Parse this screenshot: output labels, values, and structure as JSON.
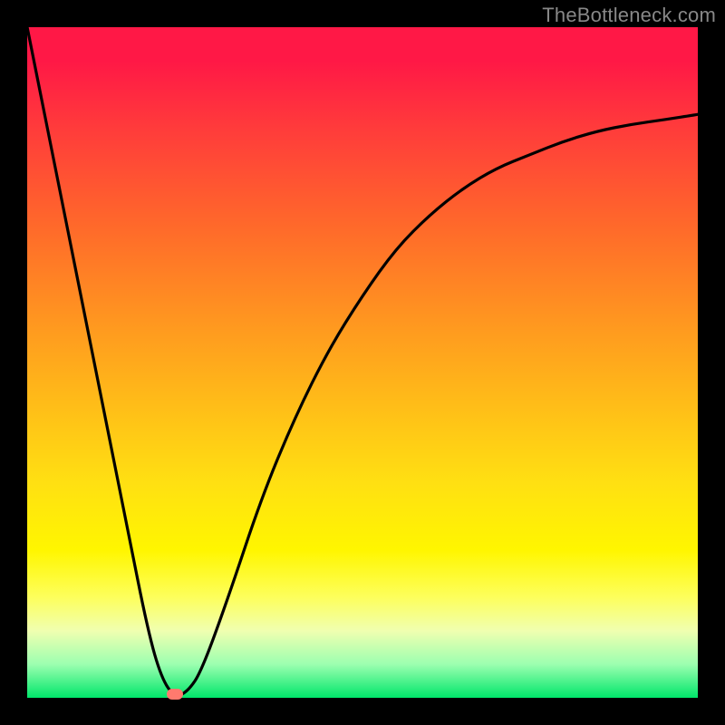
{
  "watermark": "TheBottleneck.com",
  "chart_data": {
    "type": "line",
    "title": "",
    "xlabel": "",
    "ylabel": "",
    "xlim": [
      0,
      1
    ],
    "ylim": [
      0,
      1
    ],
    "series": [
      {
        "name": "curve",
        "x": [
          0.0,
          0.05,
          0.1,
          0.15,
          0.18,
          0.2,
          0.22,
          0.24,
          0.26,
          0.3,
          0.35,
          0.4,
          0.45,
          0.5,
          0.55,
          0.6,
          0.65,
          0.7,
          0.75,
          0.8,
          0.85,
          0.9,
          0.95,
          1.0
        ],
        "y": [
          1.0,
          0.75,
          0.5,
          0.25,
          0.1,
          0.03,
          0.0,
          0.01,
          0.04,
          0.15,
          0.3,
          0.42,
          0.52,
          0.6,
          0.67,
          0.72,
          0.76,
          0.79,
          0.81,
          0.83,
          0.845,
          0.855,
          0.862,
          0.87
        ]
      }
    ],
    "annotations": [
      {
        "name": "min-marker",
        "x": 0.22,
        "y": 0.0
      }
    ],
    "gradient_stops": [
      {
        "pct": 0,
        "color": "#ff1846"
      },
      {
        "pct": 15,
        "color": "#ff3b3b"
      },
      {
        "pct": 30,
        "color": "#ff6a2a"
      },
      {
        "pct": 45,
        "color": "#ff9a1f"
      },
      {
        "pct": 58,
        "color": "#ffc217"
      },
      {
        "pct": 68,
        "color": "#ffe012"
      },
      {
        "pct": 78,
        "color": "#fff600"
      },
      {
        "pct": 85,
        "color": "#fdff5c"
      },
      {
        "pct": 90,
        "color": "#f0ffb0"
      },
      {
        "pct": 95,
        "color": "#9cffb0"
      },
      {
        "pct": 100,
        "color": "#00e66a"
      }
    ]
  }
}
